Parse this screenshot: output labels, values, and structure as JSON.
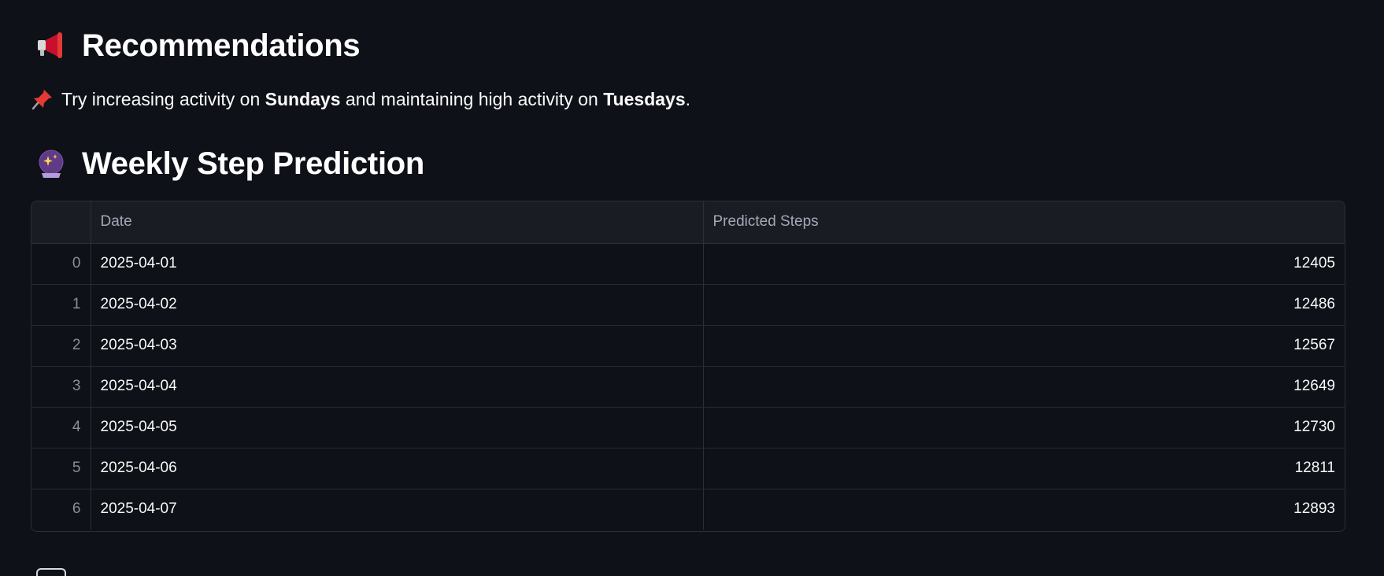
{
  "recommendations": {
    "icon": "megaphone-icon",
    "title": "Recommendations",
    "text_before": "Try increasing activity on ",
    "bold_day_1": "Sundays",
    "text_middle": " and maintaining high activity on ",
    "bold_day_2": "Tuesdays",
    "text_after": ".",
    "bullet_icon": "pushpin-icon"
  },
  "prediction": {
    "icon": "crystal-ball-icon",
    "title": "Weekly Step Prediction",
    "columns": [
      "",
      "Date",
      "Predicted Steps"
    ],
    "rows": [
      {
        "index": "0",
        "date": "2025-04-01",
        "steps": "12405"
      },
      {
        "index": "1",
        "date": "2025-04-02",
        "steps": "12486"
      },
      {
        "index": "2",
        "date": "2025-04-03",
        "steps": "12567"
      },
      {
        "index": "3",
        "date": "2025-04-04",
        "steps": "12649"
      },
      {
        "index": "4",
        "date": "2025-04-05",
        "steps": "12730"
      },
      {
        "index": "5",
        "date": "2025-04-06",
        "steps": "12811"
      },
      {
        "index": "6",
        "date": "2025-04-07",
        "steps": "12893"
      }
    ]
  },
  "colors": {
    "background": "#0e1117",
    "text": "#fafafa",
    "header_bg": "#1a1c24",
    "border": "#2b2f38"
  }
}
